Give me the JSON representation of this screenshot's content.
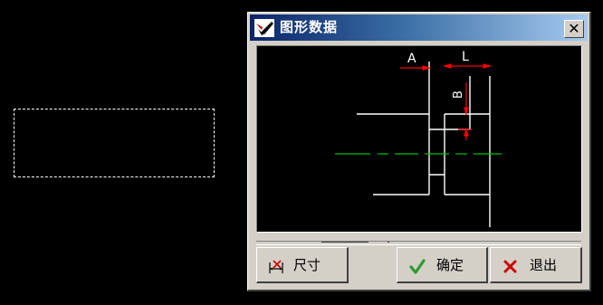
{
  "dialog": {
    "title": "图形数据",
    "close_glyph": "✕",
    "title_icon": "app-logo-icon"
  },
  "drawing": {
    "labels": {
      "a": "A",
      "l": "L",
      "b": "B"
    },
    "colors": {
      "geometry": "#ffffff",
      "dimensions": "#ff0000",
      "centerline": "#00c000"
    }
  },
  "buttons": {
    "size": {
      "label": "尺寸",
      "icon": "dimension-icon"
    },
    "ok": {
      "label": "确定",
      "icon": "checkmark-icon"
    },
    "exit": {
      "label": "退出",
      "icon": "cross-icon"
    }
  },
  "colors": {
    "desktop": "#000000",
    "dialog_face": "#d4d0c8",
    "title_start": "#0a246a",
    "title_end": "#a6caf0"
  }
}
